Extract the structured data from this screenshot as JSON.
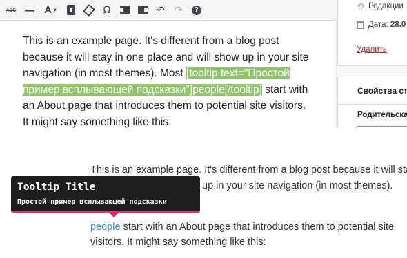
{
  "toolbar": {
    "icons": {
      "strikethrough": "ABC",
      "horizontal_line": "—",
      "text_color": "A",
      "text_color_caret": "▾",
      "special_char": "Ω",
      "undo": "↶",
      "redo": "↷",
      "help": "?"
    }
  },
  "editor": {
    "before_shortcode": "This is an example page. It's different from a blog post because it will stay in one place and will show up in your site navigation (in most themes). Most ",
    "shortcode": "[tooltip text=\"Простой пример всплывающей подсказки\"]people[/tooltip]",
    "after_shortcode": " start with an About page that introduces them to potential site visitors. It might say something like this:",
    "shortcode_highlight_color": "#8fc46b"
  },
  "sidebar": {
    "revisions_label": "Редакции",
    "date_label": "Дата:",
    "date_value": "28.0",
    "delete_link": "Удалить",
    "properties_heading": "Свойства ст",
    "parent_label": "Родительска"
  },
  "preview": {
    "line1": "This is an example page. It's different from a blog post because it will stay",
    "line2": "up in your site navigation (in most themes).",
    "link_text": "people",
    "line3_rest": " start with an About page that introduces them to potential site",
    "line4": "visitors. It might say something like this:"
  },
  "tooltip": {
    "title": "Tooltip Title",
    "text": "Простой пример всплывающей подсказки",
    "background_color": "#1e1e1e",
    "accent_color": "#e0306f"
  }
}
